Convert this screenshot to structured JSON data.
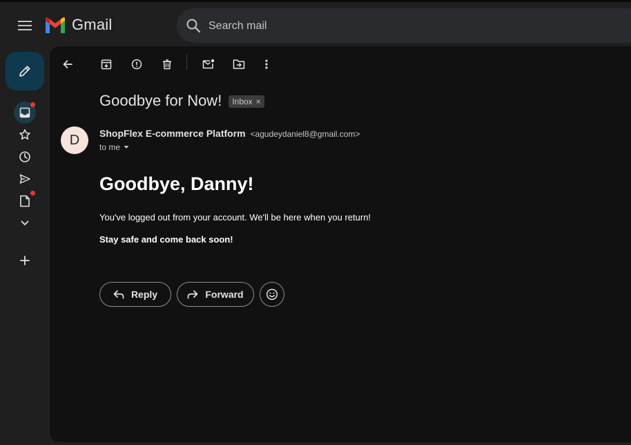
{
  "app": {
    "name": "Gmail"
  },
  "search": {
    "placeholder": "Search mail"
  },
  "toolbar": {
    "icons": [
      "back-arrow-icon",
      "archive-icon",
      "report-spam-icon",
      "delete-icon",
      "mark-unread-icon",
      "move-to-icon",
      "more-vert-icon"
    ]
  },
  "rail": {
    "icons": [
      "pencil-icon",
      "inbox-icon",
      "star-icon",
      "clock-icon",
      "send-icon",
      "draft-icon",
      "chevron-down-icon",
      "plus-icon"
    ]
  },
  "message": {
    "subject": "Goodbye for Now!",
    "label": "Inbox",
    "label_close": "×",
    "avatar_initial": "D",
    "sender_name": "ShopFlex E-commerce Platform",
    "sender_email": "<agudeydaniel8@gmail.com>",
    "to": "to me",
    "heading": "Goodbye, Danny!",
    "paragraph1": "You've logged out from your account. We'll be here when you return!",
    "paragraph2": "Stay safe and come back soon!"
  },
  "actions": {
    "reply": "Reply",
    "forward": "Forward"
  },
  "colors": {
    "background": "#1f1f1f",
    "main_panel": "#111111",
    "compose_bg": "#0f3a4d",
    "badge_red": "#e53935",
    "avatar_bg": "#f5e3dc"
  }
}
